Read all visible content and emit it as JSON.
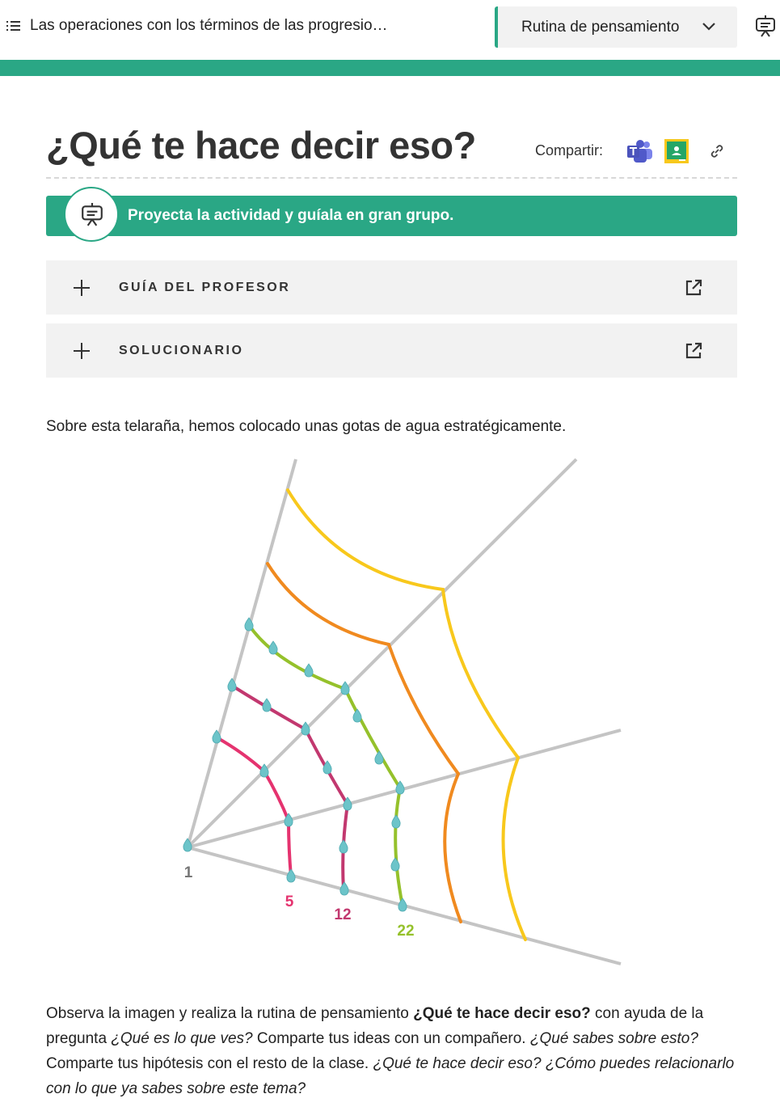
{
  "topbar": {
    "doc_title": "Las operaciones con los términos de las progresio…",
    "routine_label": "Rutina de pensamiento"
  },
  "header": {
    "title": "¿Qué te hace decir eso?",
    "share_label": "Compartir:"
  },
  "banner": {
    "text": "Proyecta la actividad y guíala en gran grupo."
  },
  "accordions": [
    {
      "label": "GUÍA DEL PROFESOR"
    },
    {
      "label": "SOLUCIONARIO"
    }
  ],
  "content": {
    "intro": "Sobre esta telaraña, hemos colocado unas gotas de agua estratégicamente.",
    "p1": "Observa la imagen y realiza la rutina de pensamiento ",
    "p1_bold": "¿Qué te hace decir eso?",
    "p1_after": " con ayuda de la pregunta ",
    "q1": "¿Qué es lo que ves?",
    "p2": " Comparte tus ideas con un compañero. ",
    "q2": "¿Qué sabes sobre esto?",
    "p3": " Comparte tus hipótesis con el resto de la clase. ",
    "q3": "¿Qué te hace decir eso? ¿Cómo puedes relacionarlo con lo que ya sabes sobre este tema?"
  },
  "figure": {
    "labels": [
      "1",
      "5",
      "12",
      "22"
    ],
    "colors": {
      "radial": "#c4c4c4",
      "drop": "#6cc4c9",
      "ring_pink": "#e5336f",
      "ring_magenta": "#c2386f",
      "ring_green": "#95c12b",
      "ring_orange": "#f08a1f",
      "ring_yellow": "#f8c81c",
      "label_grey": "#777777",
      "label_pink": "#e5336f",
      "label_magenta": "#c2386f",
      "label_green": "#95c12b"
    }
  },
  "colors": {
    "accent": "#2aa785",
    "panel": "#f2f2f2"
  },
  "icons": {
    "menu": "list-menu-icon",
    "chevron": "chevron-down-icon",
    "project": "projector-icon",
    "teams": "teams-icon",
    "classroom": "google-classroom-icon",
    "link": "link-icon",
    "plus": "plus-icon",
    "external": "external-link-icon"
  }
}
